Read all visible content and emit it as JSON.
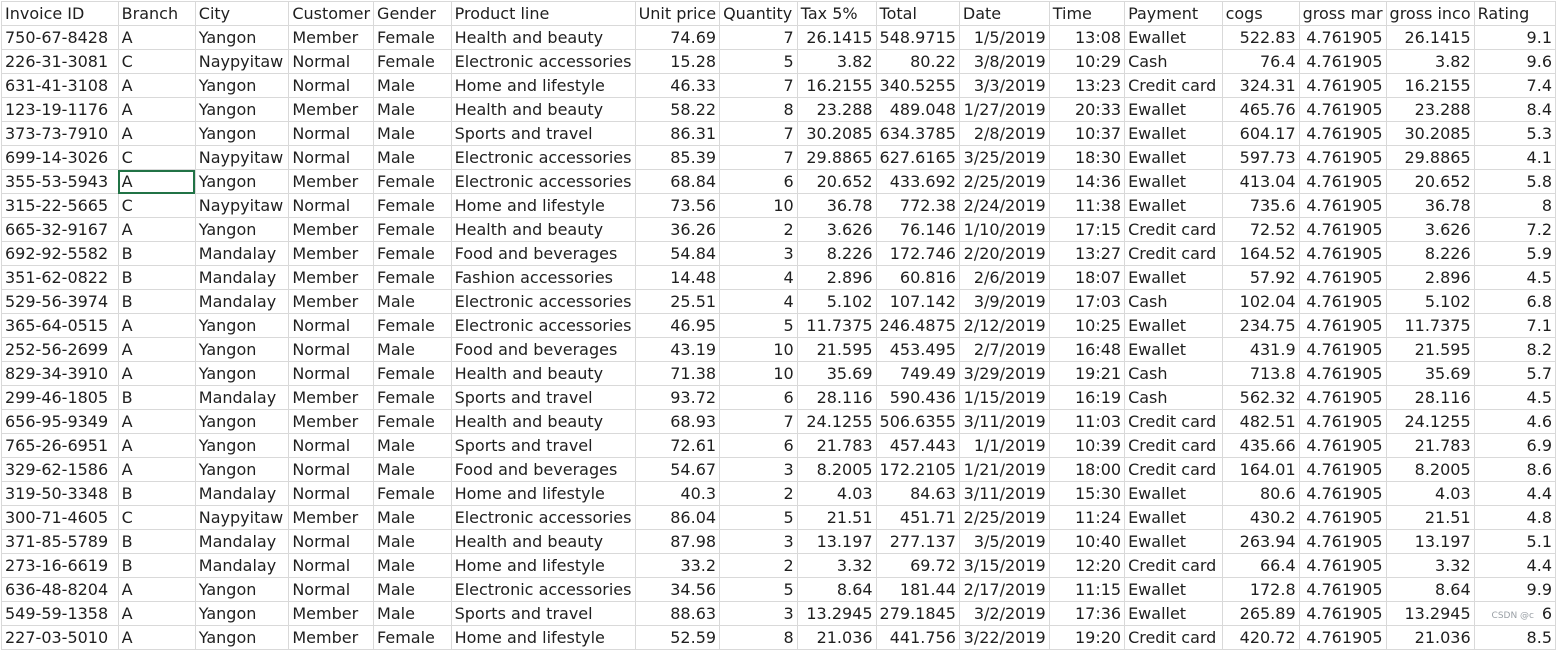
{
  "headers": [
    "Invoice ID",
    "Branch",
    "City",
    "Customer",
    "Gender",
    "Product line",
    "Unit price",
    "Quantity",
    "Tax 5%",
    "Total",
    "Date",
    "Time",
    "Payment",
    "cogs",
    "gross mar",
    "gross inco",
    "Rating"
  ],
  "numeric_columns": [
    6,
    7,
    8,
    9,
    10,
    11,
    13,
    14,
    15,
    16
  ],
  "selected_cell": {
    "row": 6,
    "col": 1
  },
  "rows": [
    [
      "750-67-8428",
      "A",
      "Yangon",
      "Member",
      "Female",
      "Health and beauty",
      "74.69",
      "7",
      "26.1415",
      "548.9715",
      "1/5/2019",
      "13:08",
      "Ewallet",
      "522.83",
      "4.761905",
      "26.1415",
      "9.1"
    ],
    [
      "226-31-3081",
      "C",
      "Naypyitaw",
      "Normal",
      "Female",
      "Electronic accessories",
      "15.28",
      "5",
      "3.82",
      "80.22",
      "3/8/2019",
      "10:29",
      "Cash",
      "76.4",
      "4.761905",
      "3.82",
      "9.6"
    ],
    [
      "631-41-3108",
      "A",
      "Yangon",
      "Normal",
      "Male",
      "Home and lifestyle",
      "46.33",
      "7",
      "16.2155",
      "340.5255",
      "3/3/2019",
      "13:23",
      "Credit card",
      "324.31",
      "4.761905",
      "16.2155",
      "7.4"
    ],
    [
      "123-19-1176",
      "A",
      "Yangon",
      "Member",
      "Male",
      "Health and beauty",
      "58.22",
      "8",
      "23.288",
      "489.048",
      "1/27/2019",
      "20:33",
      "Ewallet",
      "465.76",
      "4.761905",
      "23.288",
      "8.4"
    ],
    [
      "373-73-7910",
      "A",
      "Yangon",
      "Normal",
      "Male",
      "Sports and travel",
      "86.31",
      "7",
      "30.2085",
      "634.3785",
      "2/8/2019",
      "10:37",
      "Ewallet",
      "604.17",
      "4.761905",
      "30.2085",
      "5.3"
    ],
    [
      "699-14-3026",
      "C",
      "Naypyitaw",
      "Normal",
      "Male",
      "Electronic accessories",
      "85.39",
      "7",
      "29.8865",
      "627.6165",
      "3/25/2019",
      "18:30",
      "Ewallet",
      "597.73",
      "4.761905",
      "29.8865",
      "4.1"
    ],
    [
      "355-53-5943",
      "A",
      "Yangon",
      "Member",
      "Female",
      "Electronic accessories",
      "68.84",
      "6",
      "20.652",
      "433.692",
      "2/25/2019",
      "14:36",
      "Ewallet",
      "413.04",
      "4.761905",
      "20.652",
      "5.8"
    ],
    [
      "315-22-5665",
      "C",
      "Naypyitaw",
      "Normal",
      "Female",
      "Home and lifestyle",
      "73.56",
      "10",
      "36.78",
      "772.38",
      "2/24/2019",
      "11:38",
      "Ewallet",
      "735.6",
      "4.761905",
      "36.78",
      "8"
    ],
    [
      "665-32-9167",
      "A",
      "Yangon",
      "Member",
      "Female",
      "Health and beauty",
      "36.26",
      "2",
      "3.626",
      "76.146",
      "1/10/2019",
      "17:15",
      "Credit card",
      "72.52",
      "4.761905",
      "3.626",
      "7.2"
    ],
    [
      "692-92-5582",
      "B",
      "Mandalay",
      "Member",
      "Female",
      "Food and beverages",
      "54.84",
      "3",
      "8.226",
      "172.746",
      "2/20/2019",
      "13:27",
      "Credit card",
      "164.52",
      "4.761905",
      "8.226",
      "5.9"
    ],
    [
      "351-62-0822",
      "B",
      "Mandalay",
      "Member",
      "Female",
      "Fashion accessories",
      "14.48",
      "4",
      "2.896",
      "60.816",
      "2/6/2019",
      "18:07",
      "Ewallet",
      "57.92",
      "4.761905",
      "2.896",
      "4.5"
    ],
    [
      "529-56-3974",
      "B",
      "Mandalay",
      "Member",
      "Male",
      "Electronic accessories",
      "25.51",
      "4",
      "5.102",
      "107.142",
      "3/9/2019",
      "17:03",
      "Cash",
      "102.04",
      "4.761905",
      "5.102",
      "6.8"
    ],
    [
      "365-64-0515",
      "A",
      "Yangon",
      "Normal",
      "Female",
      "Electronic accessories",
      "46.95",
      "5",
      "11.7375",
      "246.4875",
      "2/12/2019",
      "10:25",
      "Ewallet",
      "234.75",
      "4.761905",
      "11.7375",
      "7.1"
    ],
    [
      "252-56-2699",
      "A",
      "Yangon",
      "Normal",
      "Male",
      "Food and beverages",
      "43.19",
      "10",
      "21.595",
      "453.495",
      "2/7/2019",
      "16:48",
      "Ewallet",
      "431.9",
      "4.761905",
      "21.595",
      "8.2"
    ],
    [
      "829-34-3910",
      "A",
      "Yangon",
      "Normal",
      "Female",
      "Health and beauty",
      "71.38",
      "10",
      "35.69",
      "749.49",
      "3/29/2019",
      "19:21",
      "Cash",
      "713.8",
      "4.761905",
      "35.69",
      "5.7"
    ],
    [
      "299-46-1805",
      "B",
      "Mandalay",
      "Member",
      "Female",
      "Sports and travel",
      "93.72",
      "6",
      "28.116",
      "590.436",
      "1/15/2019",
      "16:19",
      "Cash",
      "562.32",
      "4.761905",
      "28.116",
      "4.5"
    ],
    [
      "656-95-9349",
      "A",
      "Yangon",
      "Member",
      "Female",
      "Health and beauty",
      "68.93",
      "7",
      "24.1255",
      "506.6355",
      "3/11/2019",
      "11:03",
      "Credit card",
      "482.51",
      "4.761905",
      "24.1255",
      "4.6"
    ],
    [
      "765-26-6951",
      "A",
      "Yangon",
      "Normal",
      "Male",
      "Sports and travel",
      "72.61",
      "6",
      "21.783",
      "457.443",
      "1/1/2019",
      "10:39",
      "Credit card",
      "435.66",
      "4.761905",
      "21.783",
      "6.9"
    ],
    [
      "329-62-1586",
      "A",
      "Yangon",
      "Normal",
      "Male",
      "Food and beverages",
      "54.67",
      "3",
      "8.2005",
      "172.2105",
      "1/21/2019",
      "18:00",
      "Credit card",
      "164.01",
      "4.761905",
      "8.2005",
      "8.6"
    ],
    [
      "319-50-3348",
      "B",
      "Mandalay",
      "Normal",
      "Female",
      "Home and lifestyle",
      "40.3",
      "2",
      "4.03",
      "84.63",
      "3/11/2019",
      "15:30",
      "Ewallet",
      "80.6",
      "4.761905",
      "4.03",
      "4.4"
    ],
    [
      "300-71-4605",
      "C",
      "Naypyitaw",
      "Member",
      "Male",
      "Electronic accessories",
      "86.04",
      "5",
      "21.51",
      "451.71",
      "2/25/2019",
      "11:24",
      "Ewallet",
      "430.2",
      "4.761905",
      "21.51",
      "4.8"
    ],
    [
      "371-85-5789",
      "B",
      "Mandalay",
      "Normal",
      "Male",
      "Health and beauty",
      "87.98",
      "3",
      "13.197",
      "277.137",
      "3/5/2019",
      "10:40",
      "Ewallet",
      "263.94",
      "4.761905",
      "13.197",
      "5.1"
    ],
    [
      "273-16-6619",
      "B",
      "Mandalay",
      "Normal",
      "Male",
      "Home and lifestyle",
      "33.2",
      "2",
      "3.32",
      "69.72",
      "3/15/2019",
      "12:20",
      "Credit card",
      "66.4",
      "4.761905",
      "3.32",
      "4.4"
    ],
    [
      "636-48-8204",
      "A",
      "Yangon",
      "Normal",
      "Male",
      "Electronic accessories",
      "34.56",
      "5",
      "8.64",
      "181.44",
      "2/17/2019",
      "11:15",
      "Ewallet",
      "172.8",
      "4.761905",
      "8.64",
      "9.9"
    ],
    [
      "549-59-1358",
      "A",
      "Yangon",
      "Member",
      "Male",
      "Sports and travel",
      "88.63",
      "3",
      "13.2945",
      "279.1845",
      "3/2/2019",
      "17:36",
      "Ewallet",
      "265.89",
      "4.761905",
      "13.2945",
      "6"
    ],
    [
      "227-03-5010",
      "A",
      "Yangon",
      "Member",
      "Female",
      "Home and lifestyle",
      "52.59",
      "8",
      "21.036",
      "441.756",
      "3/22/2019",
      "19:20",
      "Credit card",
      "420.72",
      "4.761905",
      "21.036",
      "8.5"
    ]
  ],
  "watermark": "CSDN @c"
}
